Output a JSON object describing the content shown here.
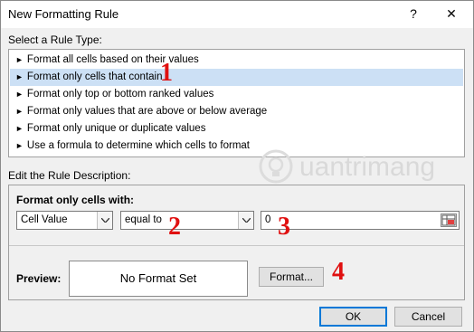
{
  "window": {
    "title": "New Formatting Rule",
    "help_glyph": "?",
    "close_glyph": "✕"
  },
  "rule_type": {
    "label": "Select a Rule Type:",
    "items": [
      "Format all cells based on their values",
      "Format only cells that contain",
      "Format only top or bottom ranked values",
      "Format only values that are above or below average",
      "Format only unique or duplicate values",
      "Use a formula to determine which cells to format"
    ],
    "selected_index": 1
  },
  "description": {
    "label": "Edit the Rule Description:",
    "heading": "Format only cells with:",
    "condition_type": "Cell Value",
    "operator": "equal to",
    "value": "0"
  },
  "preview": {
    "label": "Preview:",
    "text": "No Format Set",
    "format_button": "Format..."
  },
  "footer": {
    "ok": "OK",
    "cancel": "Cancel"
  },
  "annotations": [
    "1",
    "2",
    "3",
    "4"
  ],
  "watermark": {
    "text": "uantrimang"
  },
  "colors": {
    "annotation": "#e01010",
    "selected_row": "#cce0f5",
    "default_button_border": "#0078d7"
  }
}
